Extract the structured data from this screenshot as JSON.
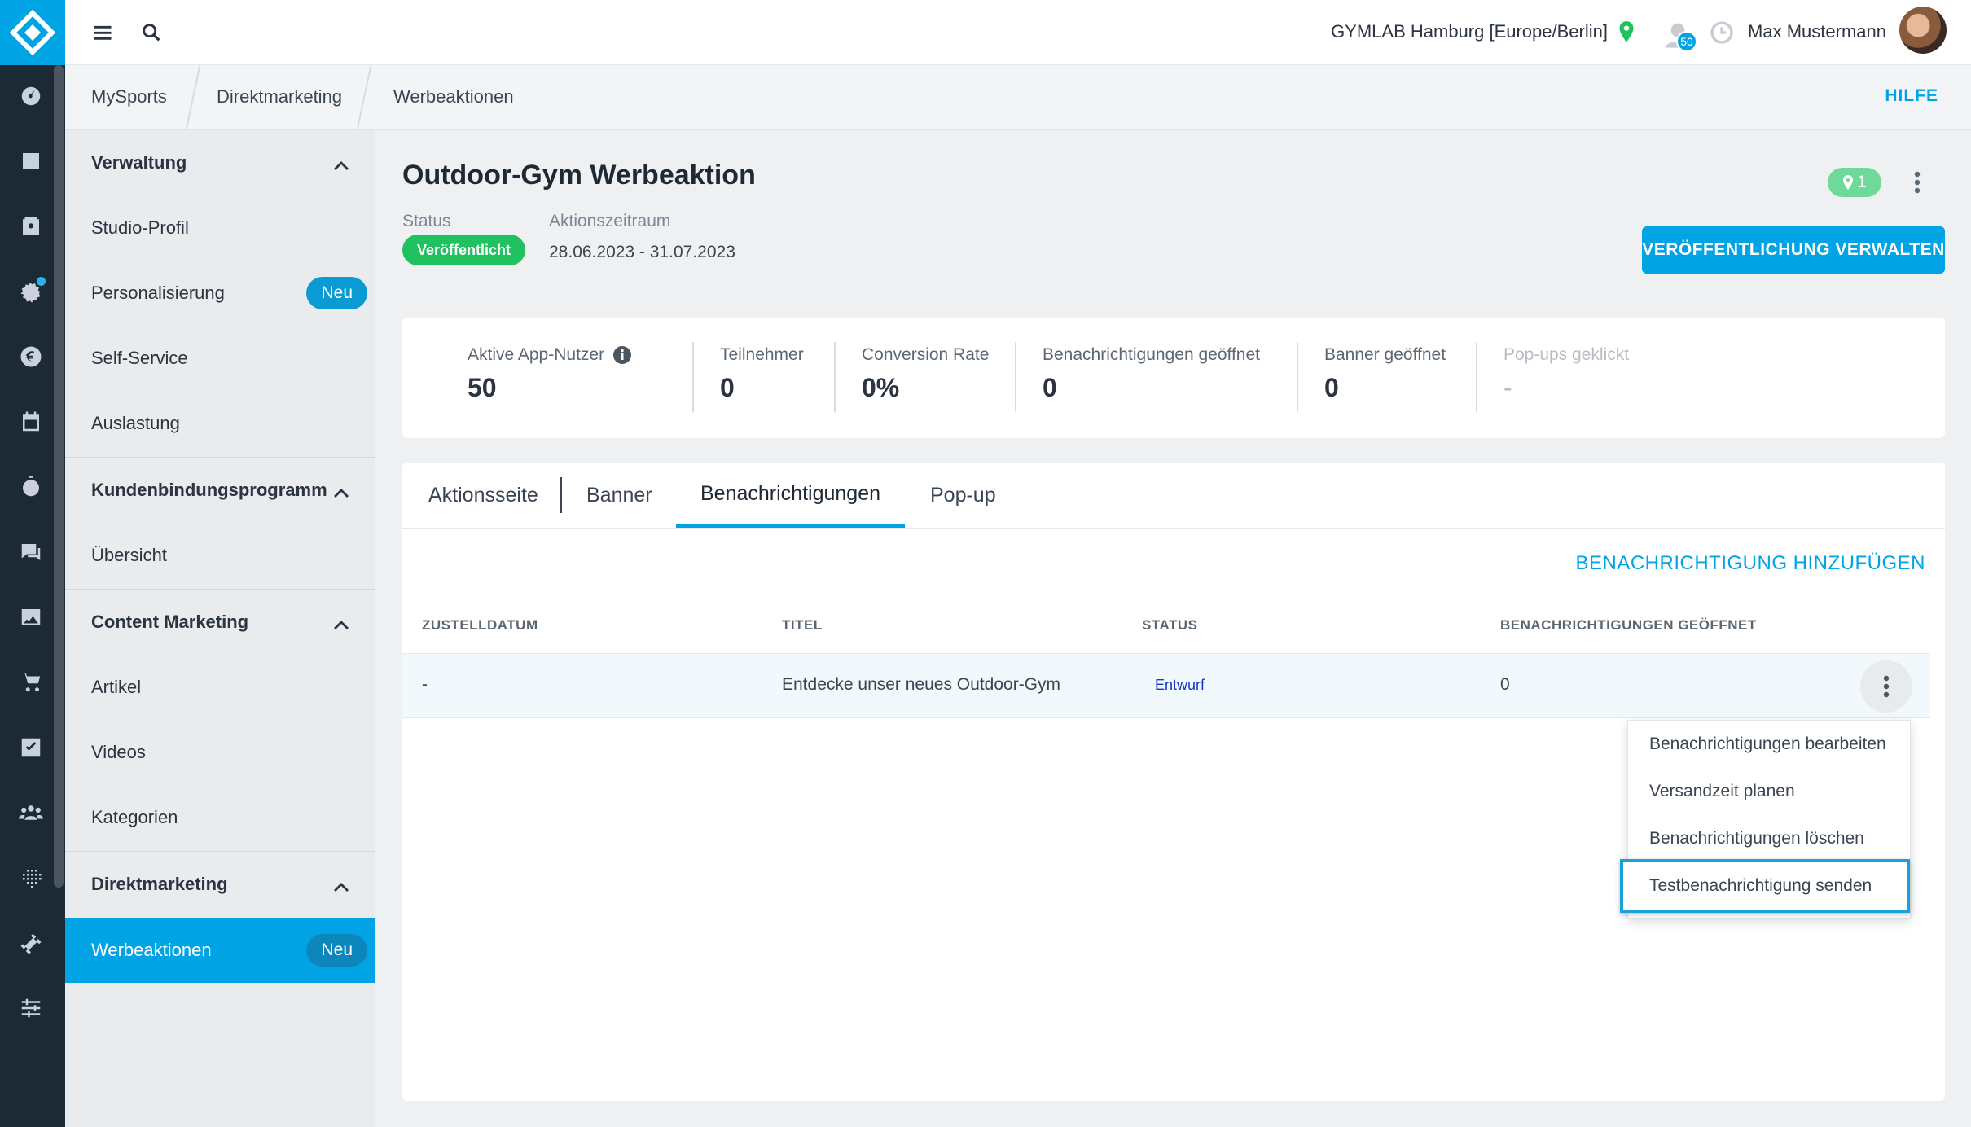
{
  "rail": {
    "icons": [
      "dashboard-icon",
      "checkin-icon",
      "contacts-icon",
      "settings-icon",
      "euro-icon",
      "calendar-icon",
      "timer-icon",
      "chat-icon",
      "image-icon",
      "cart-icon",
      "checkbox-icon",
      "group-icon",
      "dots-grid-icon",
      "dumbbell-icon",
      "sliders-icon"
    ]
  },
  "topbar": {
    "gym": "GYMLAB Hamburg [Europe/Berlin]",
    "notification_count": "50",
    "user": "Max Mustermann"
  },
  "breadcrumb": {
    "items": [
      "MySports",
      "Direktmarketing",
      "Werbeaktionen"
    ],
    "help": "HILFE"
  },
  "sidebar": {
    "sections": [
      {
        "title": "Verwaltung",
        "items": [
          "Studio-Profil",
          "Personalisierung",
          "Self-Service",
          "Auslastung"
        ]
      },
      {
        "title": "Kundenbindungsprogramm",
        "items": [
          "Übersicht"
        ]
      },
      {
        "title": "Content Marketing",
        "items": [
          "Artikel",
          "Videos",
          "Kategorien"
        ]
      },
      {
        "title": "Direktmarketing",
        "items": [
          "Werbeaktionen"
        ]
      }
    ],
    "new_badge": "Neu"
  },
  "campaign": {
    "title": "Outdoor-Gym Werbeaktion",
    "location_count": "1",
    "status_label": "Status",
    "status_value": "Veröffentlicht",
    "period_label": "Aktionszeitraum",
    "period_value": "28.06.2023 - 31.07.2023",
    "publish_button": "VERÖFFENTLICHUNG VERWALTEN"
  },
  "stats": [
    {
      "label": "Aktive App-Nutzer",
      "value": "50"
    },
    {
      "label": "Teilnehmer",
      "value": "0"
    },
    {
      "label": "Conversion Rate",
      "value": "0%"
    },
    {
      "label": "Benachrichtigungen geöffnet",
      "value": "0"
    },
    {
      "label": "Banner geöffnet",
      "value": "0"
    },
    {
      "label": "Pop-ups geklickt",
      "value": "-"
    }
  ],
  "tabs": [
    "Aktionsseite",
    "Banner",
    "Benachrichtigungen",
    "Pop-up"
  ],
  "active_tab": "Benachrichtigungen",
  "add_notification": "BENACHRICHTIGUNG HINZUFÜGEN",
  "table": {
    "headers": [
      "ZUSTELLDATUM",
      "TITEL",
      "STATUS",
      "BENACHRICHTIGUNGEN GEÖFFNET"
    ],
    "rows": [
      {
        "date": "-",
        "title": "Entdecke unser neues Outdoor-Gym",
        "status": "Entwurf",
        "opened": "0"
      }
    ]
  },
  "menu": {
    "items": [
      "Benachrichtigungen bearbeiten",
      "Versandzeit planen",
      "Benachrichtigungen löschen",
      "Testbenachrichtigung senden"
    ],
    "highlighted": "Testbenachrichtigung senden"
  },
  "colors": {
    "accent": "#00a4e4",
    "rail": "#1c2a36",
    "published": "#1fc25e",
    "draft_text": "#1434c8"
  }
}
